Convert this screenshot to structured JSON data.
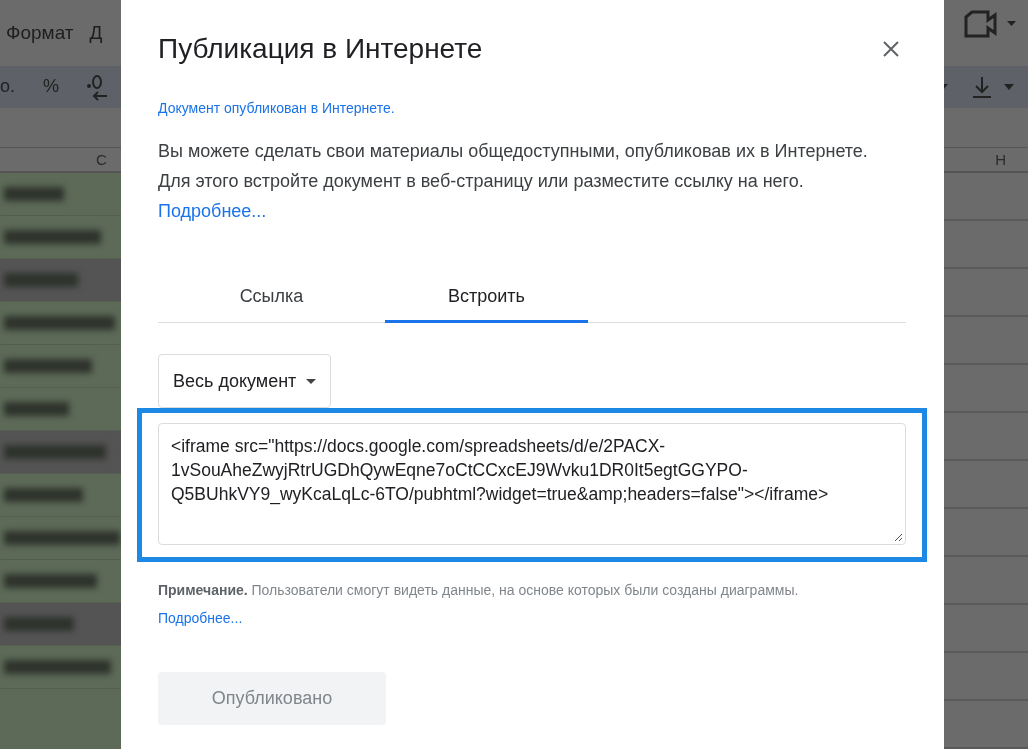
{
  "background": {
    "menu": [
      "Формат",
      "Д"
    ],
    "toolbar": [
      "о.",
      "%"
    ],
    "columns": [
      "C",
      "H"
    ]
  },
  "dialog": {
    "title": "Публикация в Интернете",
    "status_link": "Документ опубликован в Интернете.",
    "description": {
      "text": "Вы можете сделать свои материалы общедоступными, опубликовав их в Интернете. Для этого встройте документ в веб-страницу или разместите ссылку на него.",
      "link": "Подробнее..."
    },
    "tabs": [
      {
        "label": "Ссылка",
        "selected": false
      },
      {
        "label": "Встроить",
        "selected": true
      }
    ],
    "scope_dropdown": "Весь документ",
    "embed_code": "<iframe src=\"https://docs.google.com/spreadsheets/d/e/2PACX-1vSouAheZwyjRtrUGDhQywEqne7oCtCCxcEJ9Wvku1DR0It5egtGGYPO-Q5BUhkVY9_wyKcaLqLc-6TO/pubhtml?widget=true&amp;headers=false\"></iframe>",
    "note": {
      "label": "Примечание.",
      "text": "Пользователи смогут видеть данные, на основе которых были созданы диаграммы.",
      "link": "Подробнее..."
    },
    "publish_button": {
      "label": "Опубликовано",
      "disabled": true
    }
  }
}
